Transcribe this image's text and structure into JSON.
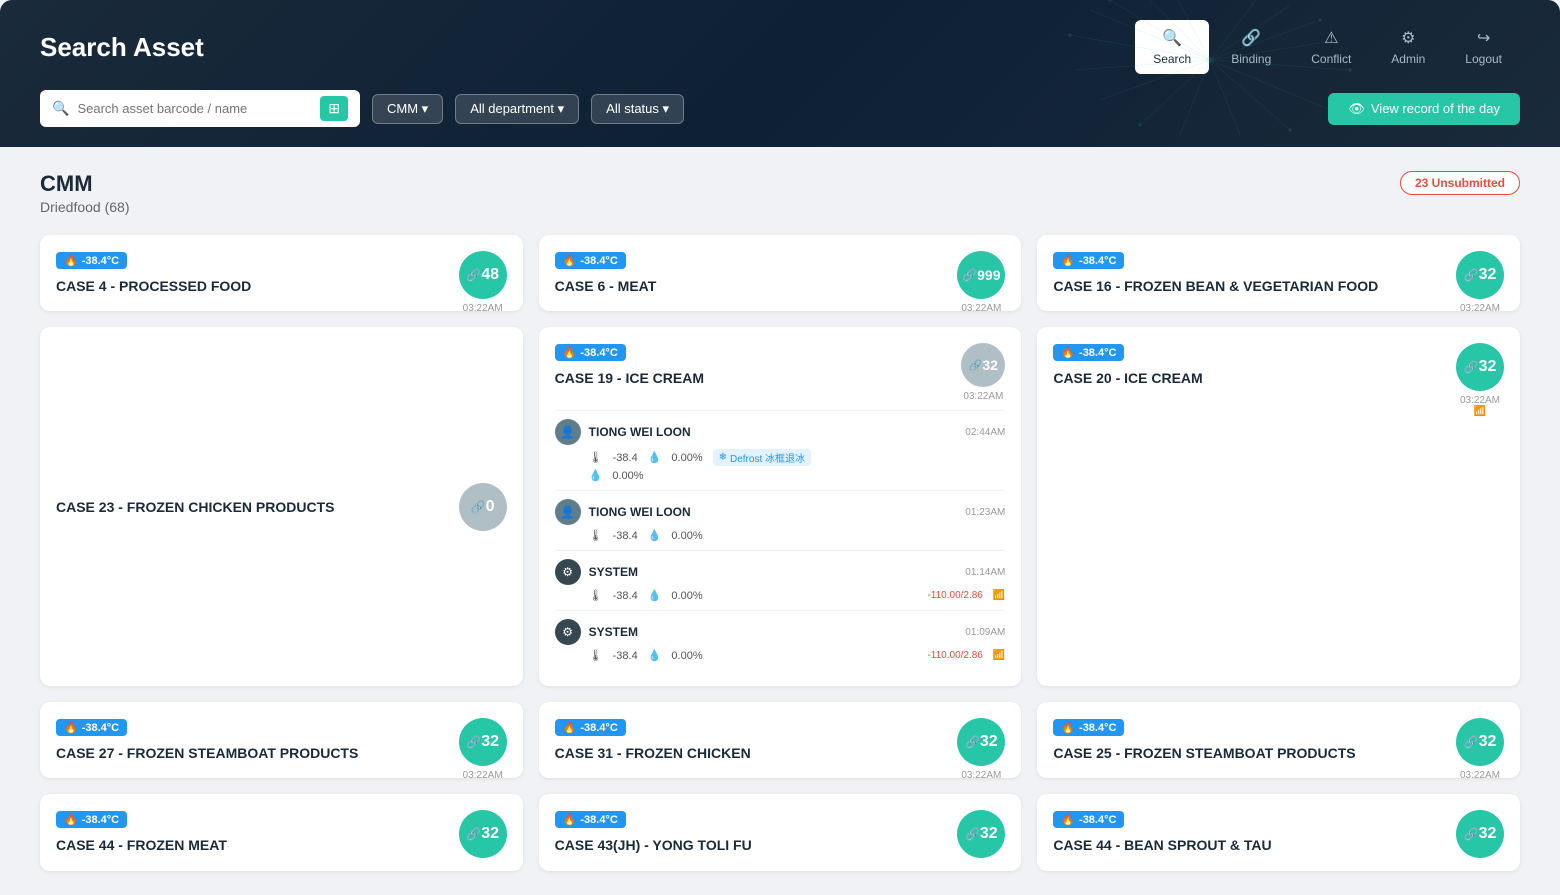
{
  "header": {
    "title": "Search Asset",
    "search_placeholder": "Search asset barcode / name",
    "nav": [
      {
        "id": "search",
        "label": "Search",
        "icon": "🔍",
        "active": true
      },
      {
        "id": "binding",
        "label": "Binding",
        "icon": "🔗",
        "active": false
      },
      {
        "id": "conflict",
        "label": "Conflict",
        "icon": "⚠",
        "active": false
      },
      {
        "id": "admin",
        "label": "Admin",
        "icon": "⚙",
        "active": false
      },
      {
        "id": "logout",
        "label": "Logout",
        "icon": "↪",
        "active": false
      }
    ],
    "filters": [
      "CMM ▾",
      "All department ▾",
      "All status ▾"
    ],
    "view_record_btn": "View record of the day"
  },
  "section": {
    "title": "CMM",
    "subtitle": "Driedfood (68)",
    "unsubmitted": "23 Unsubmitted"
  },
  "cards": [
    {
      "id": "card1",
      "temp": "-38.4°C",
      "name": "CASE 4 - PROCESSED FOOD",
      "value": 48,
      "value_type": "green",
      "time": "03:22AM",
      "has_signal": true
    },
    {
      "id": "card2",
      "temp": "-38.4°C",
      "name": "CASE 6 - MEAT",
      "value": 999,
      "value_type": "green",
      "time": "03:22AM",
      "has_signal": true
    },
    {
      "id": "card3",
      "temp": "-38.4°C",
      "name": "CASE 16 - FROZEN BEAN & VEGETARIAN FOOD",
      "value": 32,
      "value_type": "green",
      "time": "03:22AM",
      "has_signal": true
    },
    {
      "id": "card4",
      "temp": null,
      "name": "CASE 23 - FROZEN CHICKEN PRODUCTS",
      "value": 0,
      "value_type": "gray",
      "time": "",
      "has_signal": false
    },
    {
      "id": "card5_expanded",
      "temp": "-38.4°C",
      "name": "CASE 19 - ICE CREAM",
      "value": 32,
      "value_type": "gray",
      "time": "03:22AM",
      "has_signal": false,
      "expanded": true,
      "activities": [
        {
          "type": "user",
          "name": "TIONG WEI LOON",
          "time": "02:44AM",
          "temp": "-38.4",
          "humidity": "0.00%",
          "has_defrost": true,
          "defrost_label": "Defrost 冰框退冰",
          "extra_humidity": "0.00%",
          "change": null
        },
        {
          "type": "user",
          "name": "TIONG WEI LOON",
          "time": "01:23AM",
          "temp": "-38.4",
          "humidity": "0.00%",
          "has_defrost": false,
          "change": null
        },
        {
          "type": "system",
          "name": "SYSTEM",
          "time": "01:14AM",
          "temp": "-38.4",
          "humidity": "0.00%",
          "has_defrost": false,
          "change": "-110.00/2.86"
        },
        {
          "type": "system",
          "name": "SYSTEM",
          "time": "01:09AM",
          "temp": "-38.4",
          "humidity": "0.00%",
          "has_defrost": false,
          "change": "-110.00/2.86"
        }
      ]
    },
    {
      "id": "card6",
      "temp": "-38.4°C",
      "name": "CASE 20 - ICE CREAM",
      "value": 32,
      "value_type": "green",
      "time": "03:22AM",
      "has_signal": true
    },
    {
      "id": "card7",
      "temp": "-38.4°C",
      "name": "CASE 27 - FROZEN STEAMBOAT PRODUCTS",
      "value": 32,
      "value_type": "green",
      "time": "03:22AM",
      "has_signal": true
    },
    {
      "id": "card8",
      "temp": "-38.4°C",
      "name": "CASE 31 - FROZEN CHICKEN",
      "value": 32,
      "value_type": "green",
      "time": "03:22AM",
      "has_signal": true
    },
    {
      "id": "card9",
      "temp": "-38.4°C",
      "name": "CASE 25 - FROZEN STEAMBOAT PRODUCTS",
      "value": 32,
      "value_type": "green",
      "time": "03:22AM",
      "has_signal": true
    },
    {
      "id": "card10",
      "temp": "-38.4°C",
      "name": "CASE 44 - FROZEN MEAT",
      "value": 32,
      "value_type": "green",
      "time": "",
      "has_signal": false
    },
    {
      "id": "card11",
      "temp": "-38.4°C",
      "name": "CASE 43(JH) - YONG TOLI FU",
      "value": 32,
      "value_type": "green",
      "time": "",
      "has_signal": false
    },
    {
      "id": "card12",
      "temp": "-38.4°C",
      "name": "CASE 44 - BEAN SPROUT & TAU",
      "value": 32,
      "value_type": "green",
      "time": "",
      "has_signal": false
    }
  ]
}
